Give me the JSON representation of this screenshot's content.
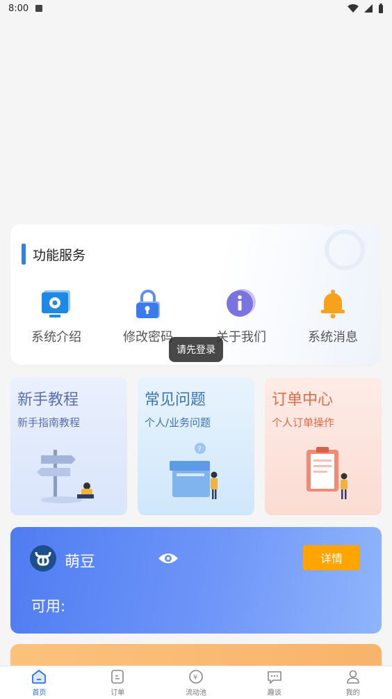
{
  "status_bar": {
    "time": "8:00"
  },
  "services": {
    "title": "功能服务",
    "items": [
      {
        "label": "系统介绍",
        "icon": "monitor-gear-icon"
      },
      {
        "label": "修改密码",
        "icon": "lock-icon"
      },
      {
        "label": "关于我们",
        "icon": "info-icon"
      },
      {
        "label": "系统消息",
        "icon": "bell-icon"
      }
    ]
  },
  "toast": "请先登录",
  "features": [
    {
      "title": "新手教程",
      "subtitle": "新手指南教程"
    },
    {
      "title": "常见问题",
      "subtitle": "个人/业务问题"
    },
    {
      "title": "订单中心",
      "subtitle": "个人订单操作"
    }
  ],
  "bean": {
    "name": "萌豆",
    "detail_label": "详情",
    "available_label": "可用:"
  },
  "tabbar": [
    {
      "label": "首页",
      "icon": "home-icon",
      "active": true
    },
    {
      "label": "订单",
      "icon": "order-icon"
    },
    {
      "label": "流动池",
      "icon": "yuan-pool-icon"
    },
    {
      "label": "趣谈",
      "icon": "chat-icon"
    },
    {
      "label": "我的",
      "icon": "profile-icon"
    }
  ],
  "colors": {
    "accent": "#2f80ed",
    "detail_button": "#ffa400"
  }
}
